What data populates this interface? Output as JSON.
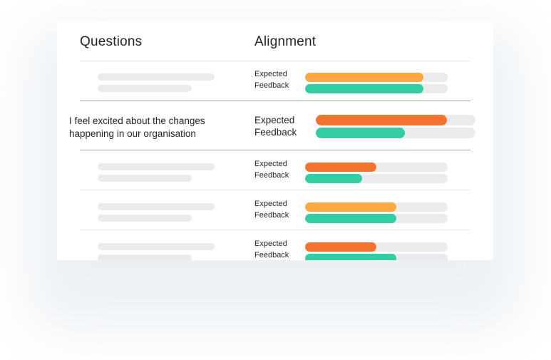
{
  "headers": {
    "questions": "Questions",
    "alignment": "Alignment"
  },
  "labels": {
    "expected": "Expected",
    "feedback": "Feedback"
  },
  "colors": {
    "expected_high": "#fba842",
    "expected_low": "#f37230",
    "feedback": "#33cda3",
    "track": "#ebebed",
    "placeholder": "#ebebed"
  },
  "rows": [
    {
      "question": null,
      "placeholder": true,
      "expected_percent": 83,
      "expected_color": "#fba842",
      "feedback_percent": 83,
      "feedback_color": "#33cda3"
    },
    {
      "question": "I feel excited about the changes happening in our organisation",
      "placeholder": false,
      "highlighted": true,
      "expected_percent": 82,
      "expected_color": "#f37230",
      "feedback_percent": 56,
      "feedback_color": "#33cda3"
    },
    {
      "question": null,
      "placeholder": true,
      "expected_percent": 50,
      "expected_color": "#f37230",
      "feedback_percent": 40,
      "feedback_color": "#33cda3"
    },
    {
      "question": null,
      "placeholder": true,
      "expected_percent": 64,
      "expected_color": "#fba842",
      "feedback_percent": 64,
      "feedback_color": "#33cda3"
    },
    {
      "question": null,
      "placeholder": true,
      "expected_percent": 50,
      "expected_color": "#f37230",
      "feedback_percent": 64,
      "feedback_color": "#33cda3"
    }
  ]
}
